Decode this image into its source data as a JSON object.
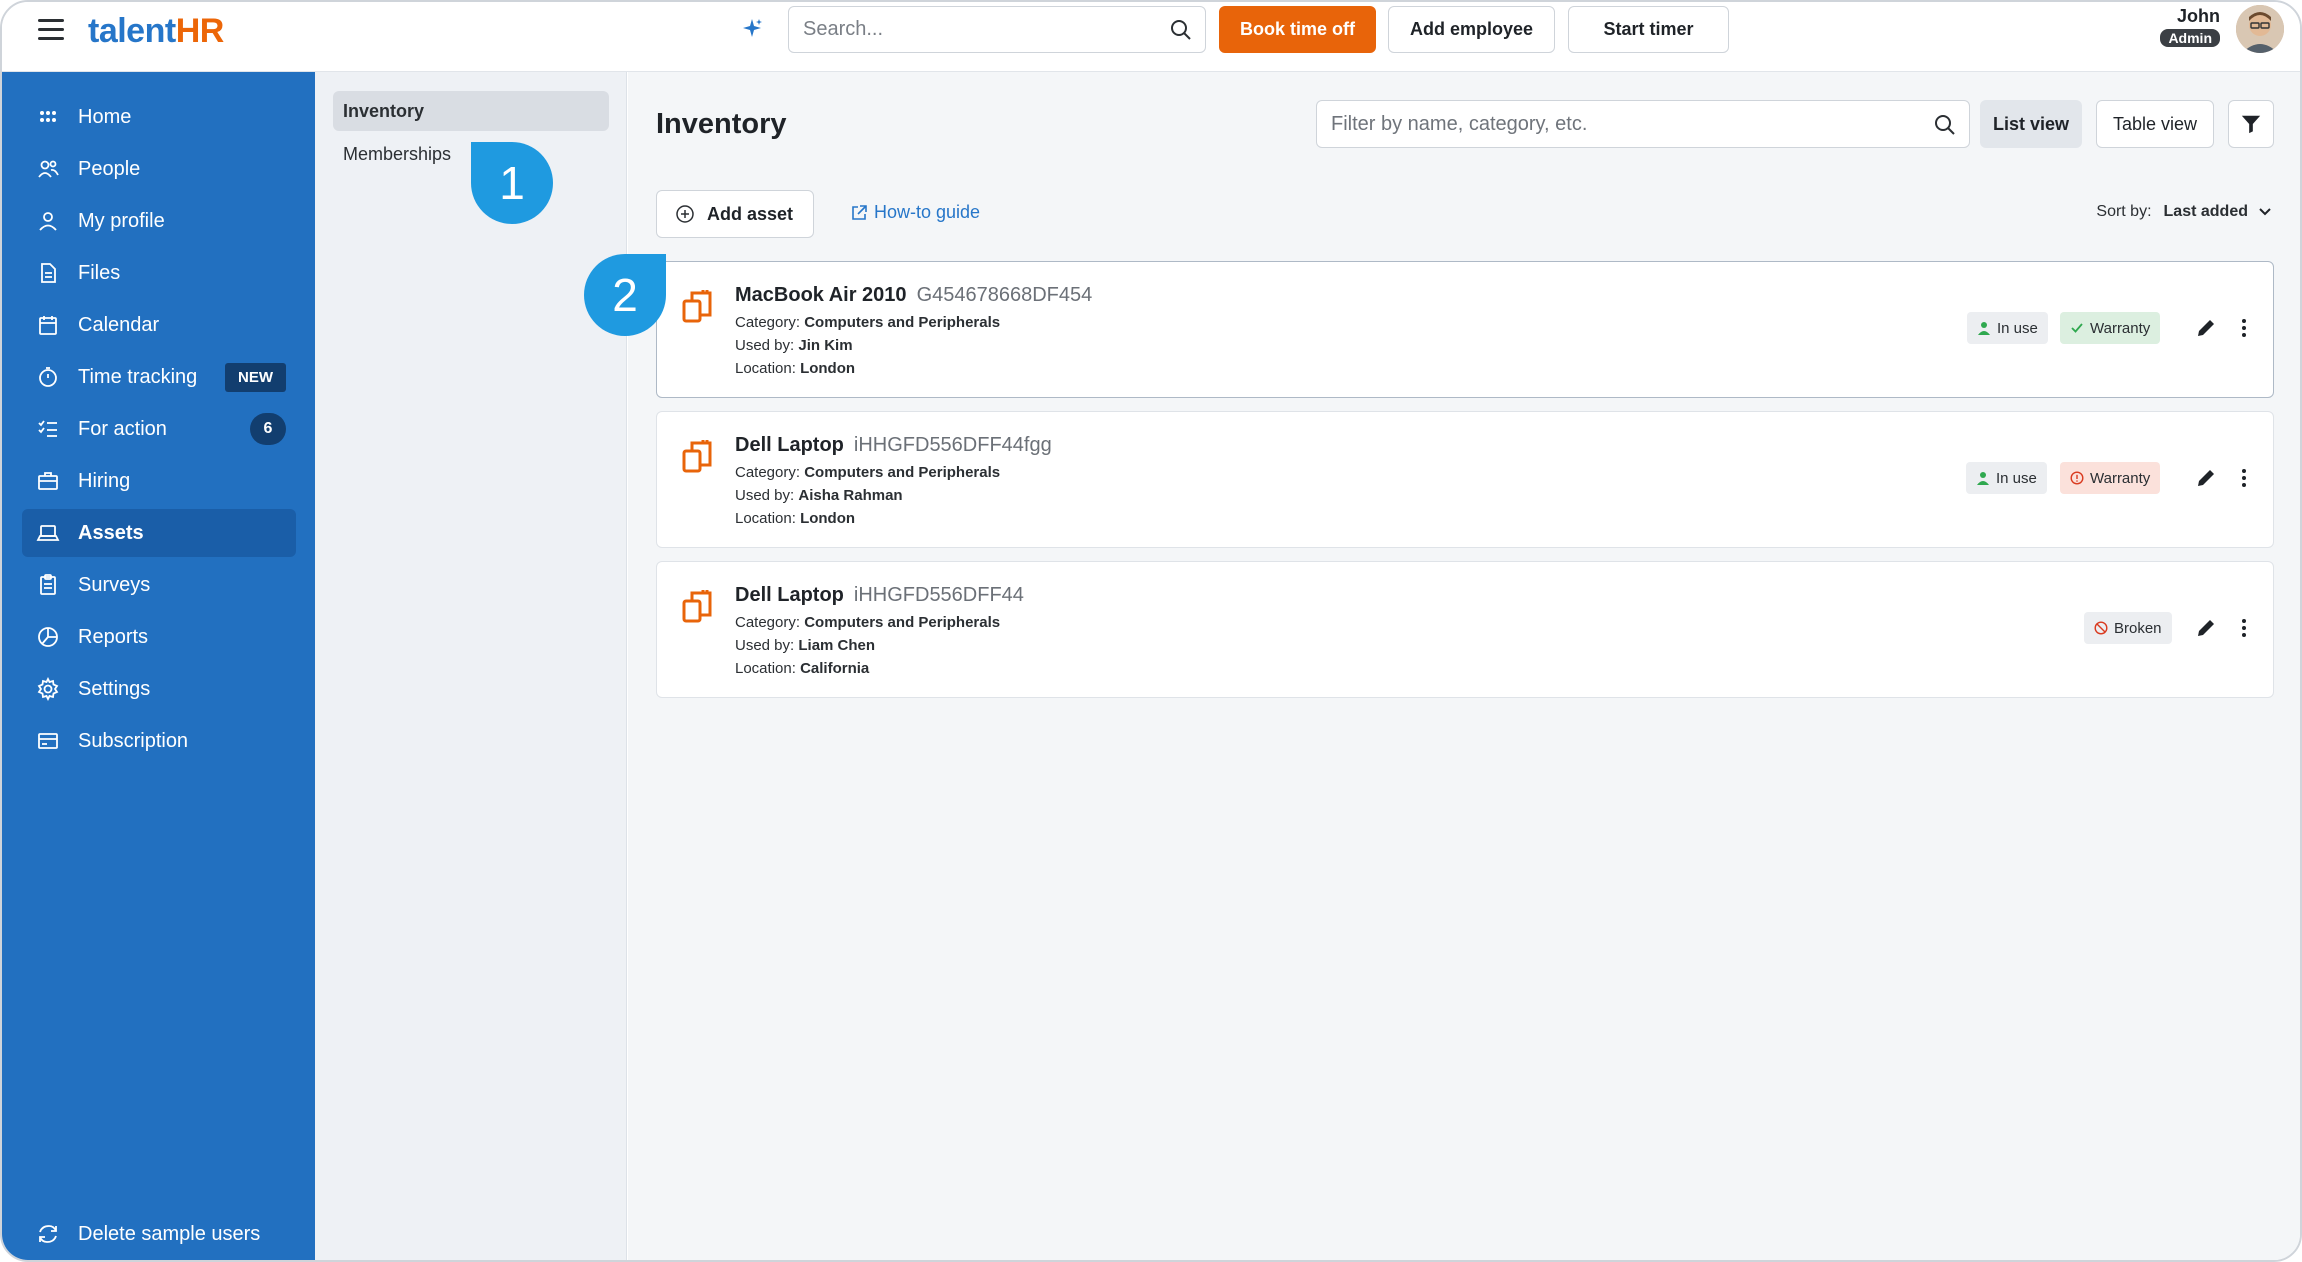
{
  "app": {
    "logo_part1": "talent",
    "logo_part2": "HR"
  },
  "header": {
    "search_placeholder": "Search...",
    "book_time_off": "Book time off",
    "add_employee": "Add employee",
    "start_timer": "Start timer",
    "user_name": "John",
    "user_role": "Admin"
  },
  "sidebar": {
    "items": [
      {
        "label": "Home",
        "icon": "home-icon"
      },
      {
        "label": "People",
        "icon": "people-icon"
      },
      {
        "label": "My profile",
        "icon": "user-icon"
      },
      {
        "label": "Files",
        "icon": "file-icon"
      },
      {
        "label": "Calendar",
        "icon": "calendar-icon"
      },
      {
        "label": "Time tracking",
        "icon": "stopwatch-icon",
        "badge": "NEW"
      },
      {
        "label": "For action",
        "icon": "checklist-icon",
        "count": "6"
      },
      {
        "label": "Hiring",
        "icon": "briefcase-icon"
      },
      {
        "label": "Assets",
        "icon": "laptop-icon",
        "active": true
      },
      {
        "label": "Surveys",
        "icon": "clipboard-icon"
      },
      {
        "label": "Reports",
        "icon": "pie-chart-icon"
      },
      {
        "label": "Settings",
        "icon": "gear-icon"
      },
      {
        "label": "Subscription",
        "icon": "credit-card-icon"
      }
    ],
    "footer_label": "Delete sample users"
  },
  "subnav": {
    "items": [
      {
        "label": "Inventory",
        "active": true
      },
      {
        "label": "Memberships"
      }
    ]
  },
  "main": {
    "title": "Inventory",
    "filter_placeholder": "Filter by name, category, etc.",
    "list_view": "List view",
    "table_view": "Table view",
    "add_asset": "Add asset",
    "how_to": "How-to guide",
    "sort_label": "Sort by:",
    "sort_value": "Last added"
  },
  "assets": [
    {
      "name": "MacBook Air 2010",
      "serial": "G454678668DF454",
      "category_label": "Category:",
      "category": "Computers and Peripherals",
      "used_label": "Used by:",
      "used_by": "Jin Kim",
      "location_label": "Location:",
      "location": "London",
      "status1": "In use",
      "status2": "Warranty",
      "status2_state": "valid"
    },
    {
      "name": "Dell Laptop",
      "serial": "iHHGFD556DFF44fgg",
      "category_label": "Category:",
      "category": "Computers and Peripherals",
      "used_label": "Used by:",
      "used_by": "Aisha Rahman",
      "location_label": "Location:",
      "location": "London",
      "status1": "In use",
      "status2": "Warranty",
      "status2_state": "expired"
    },
    {
      "name": "Dell Laptop",
      "serial": "iHHGFD556DFF44",
      "category_label": "Category:",
      "category": "Computers and Peripherals",
      "used_label": "Used by:",
      "used_by": "Liam Chen",
      "location_label": "Location:",
      "location": "California",
      "status1": "Broken"
    }
  ],
  "callouts": {
    "one": "1",
    "two": "2"
  },
  "colors": {
    "brand_blue": "#2270c0",
    "brand_orange": "#e8640a",
    "callout_blue": "#1f9ae0"
  }
}
